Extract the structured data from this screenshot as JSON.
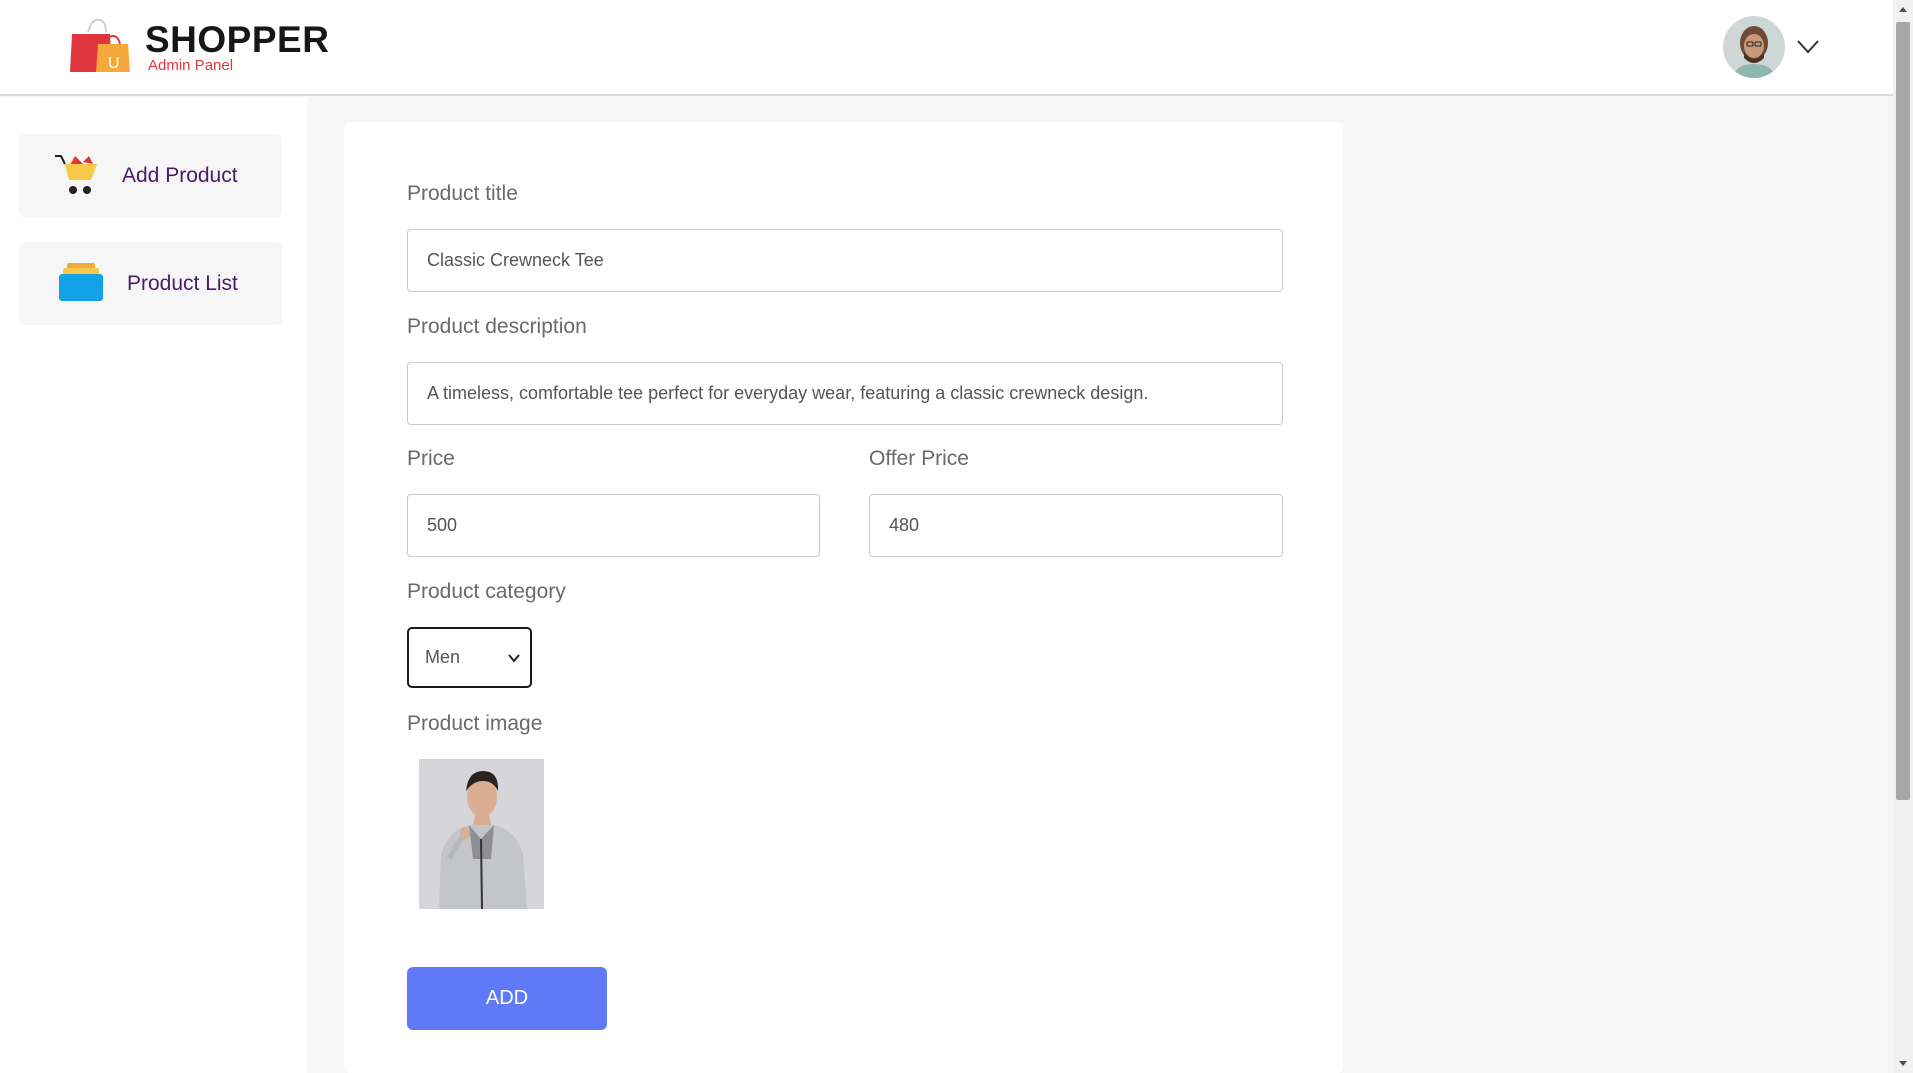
{
  "header": {
    "brand_title": "SHOPPER",
    "brand_subtitle": "Admin Panel",
    "avatar_icon": "user-avatar",
    "menu_icon": "chevron-down-icon"
  },
  "sidebar": {
    "items": [
      {
        "label": "Add Product",
        "icon": "cart-icon"
      },
      {
        "label": "Product List",
        "icon": "stack-icon"
      }
    ]
  },
  "form": {
    "title_label": "Product title",
    "title_value": "Classic Crewneck Tee",
    "description_label": "Product description",
    "description_value": "A timeless, comfortable tee perfect for everyday wear, featuring a classic crewneck design.",
    "price_label": "Price",
    "price_value": "500",
    "offer_price_label": "Offer Price",
    "offer_price_value": "480",
    "category_label": "Product category",
    "category_value": "Men",
    "image_label": "Product image",
    "add_button": "ADD"
  },
  "colors": {
    "accent": "#6079f6",
    "brand_red": "#e0353f",
    "sidebar_text": "#4b1a6b"
  }
}
